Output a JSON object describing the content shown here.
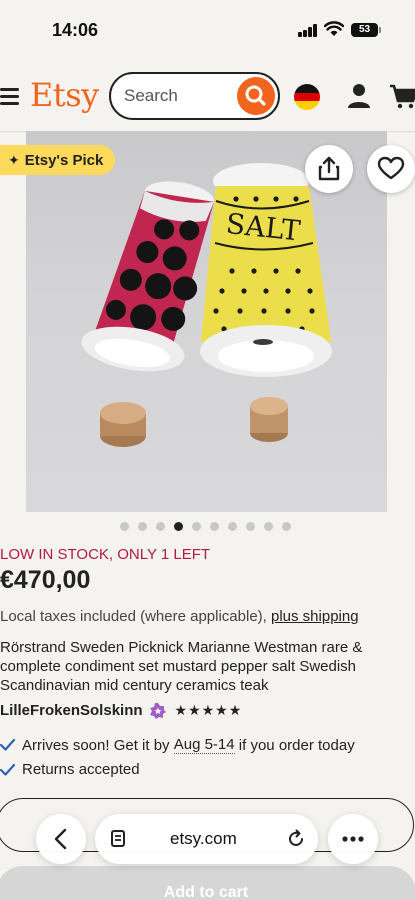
{
  "status_bar": {
    "time": "14:06",
    "battery": "53"
  },
  "header": {
    "logo": "Etsy",
    "search_placeholder": "Search"
  },
  "product": {
    "badge": "Etsy's Pick",
    "image_count": 10,
    "active_image_index": 3,
    "stock_notice": "LOW IN STOCK, ONLY 1 LEFT",
    "price": "€470,00",
    "tax_text": "Local taxes included (where applicable),",
    "shipping_link": "plus shipping",
    "title": "Rörstrand Sweden Picknick Marianne Westman rare & complete condiment set mustard pepper salt Swedish Scandinavian mid century ceramics teak",
    "seller": "LilleFrokenSolskinn",
    "rating_stars": "★★★★★",
    "arrives_prefix": "Arrives soon! Get it by",
    "arrives_dates": "Aug 5-14",
    "arrives_suffix": "if you order today",
    "returns": "Returns accepted",
    "buy_button": "",
    "add_to_cart": "Add to cart"
  },
  "browser": {
    "url": "etsy.com"
  },
  "colors": {
    "brand": "#f1641e",
    "stock": "#b3174a",
    "badge": "#fdd95c"
  }
}
